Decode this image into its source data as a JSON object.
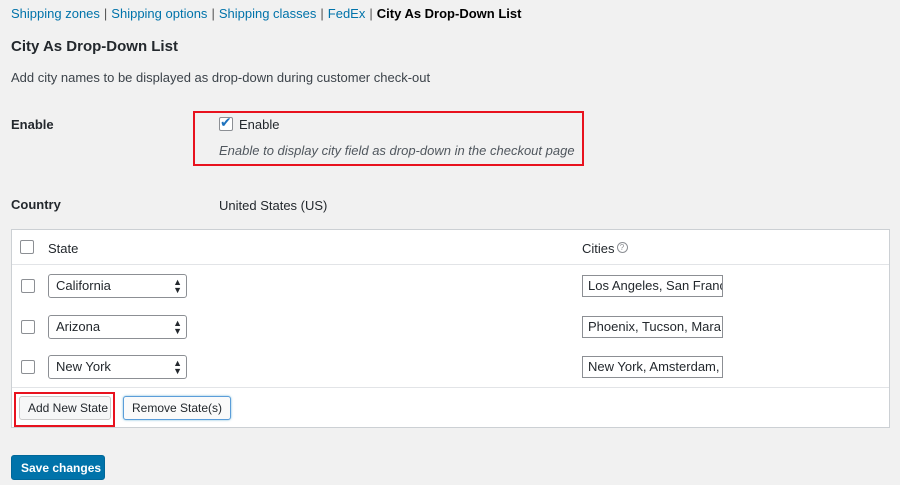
{
  "subnav": {
    "items": [
      "Shipping zones",
      "Shipping options",
      "Shipping classes",
      "FedEx"
    ],
    "separator": "|",
    "current": "City As Drop-Down List"
  },
  "section": {
    "title": "City As Drop-Down List",
    "description": "Add city names to be displayed as drop-down during customer check-out"
  },
  "enable": {
    "label": "Enable",
    "checkbox_label": "Enable",
    "checked": true,
    "hint": "Enable to display city field as drop-down in the checkout page"
  },
  "country": {
    "label": "Country",
    "value": "United States (US)"
  },
  "table": {
    "headers": {
      "state": "State",
      "cities": "Cities"
    },
    "help_icon": "?",
    "rows": [
      {
        "state": "California",
        "cities": "Los Angeles, San Francisco"
      },
      {
        "state": "Arizona",
        "cities": "Phoenix, Tucson, Mara"
      },
      {
        "state": "New York",
        "cities": "New York, Amsterdam,"
      }
    ]
  },
  "buttons": {
    "add_state": "Add New State",
    "remove_state": "Remove State(s)",
    "save": "Save changes"
  },
  "colors": {
    "link": "#0073aa",
    "primary_button": "#0073aa",
    "highlight_box": "#e8121e"
  }
}
